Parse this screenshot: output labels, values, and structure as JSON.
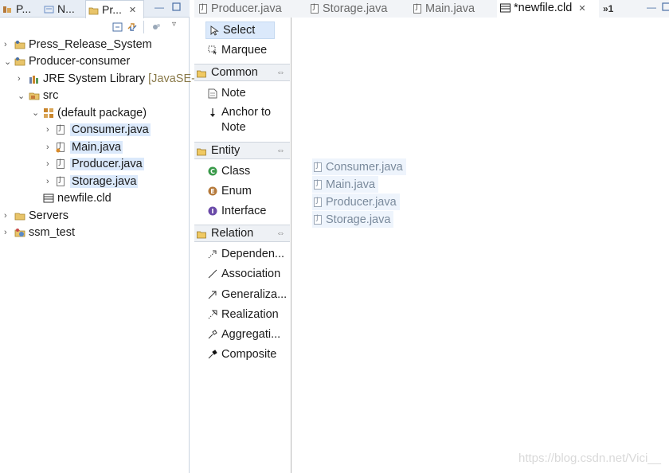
{
  "left_tabs": [
    {
      "label": "P..."
    },
    {
      "label": "N..."
    },
    {
      "label": "Pr...",
      "close": "✕"
    }
  ],
  "tree": {
    "items": [
      {
        "label": "Press_Release_System"
      },
      {
        "label": "Producer-consumer"
      },
      {
        "label": "JRE System Library",
        "suffix": "[JavaSE-"
      },
      {
        "label": "src"
      },
      {
        "label": "(default package)"
      },
      {
        "label": "Consumer.java"
      },
      {
        "label": "Main.java"
      },
      {
        "label": "Producer.java"
      },
      {
        "label": "Storage.java"
      },
      {
        "label": "newfile.cld"
      },
      {
        "label": "Servers"
      },
      {
        "label": "ssm_test"
      }
    ]
  },
  "palette": {
    "select": "Select",
    "marquee": "Marquee",
    "groups": {
      "common": {
        "label": "Common",
        "items": [
          "Note",
          "Anchor to Note"
        ]
      },
      "entity": {
        "label": "Entity",
        "items": [
          "Class",
          "Enum",
          "Interface"
        ]
      },
      "relation": {
        "label": "Relation",
        "items": [
          "Dependen...",
          "Association",
          "Generaliza...",
          "Realization",
          "Aggregati...",
          "Composite"
        ]
      }
    }
  },
  "editor_tabs": [
    {
      "label": "Producer.java"
    },
    {
      "label": "Storage.java"
    },
    {
      "label": "Main.java"
    },
    {
      "label": "*newfile.cld",
      "close": "✕"
    },
    {
      "label": "»1"
    }
  ],
  "canvas": {
    "files": [
      "Consumer.java",
      "Main.java",
      "Producer.java",
      "Storage.java"
    ]
  },
  "watermark": "https://blog.csdn.net/Vici__",
  "colors": {
    "selection": "#dbe9fb",
    "tab_bar": "#e7edf5",
    "accent": "#4a6fa5"
  }
}
